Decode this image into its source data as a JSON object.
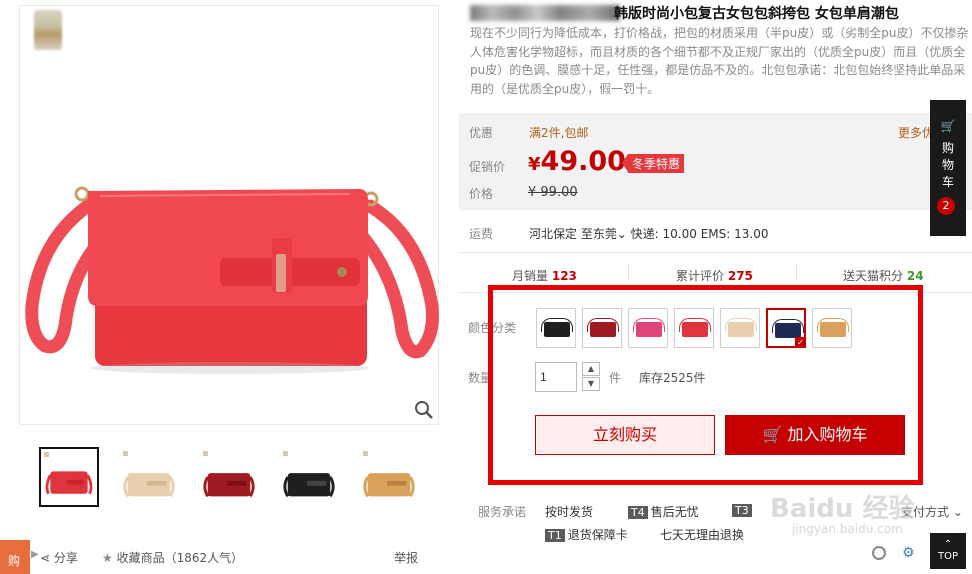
{
  "product": {
    "title": "韩版时尚小包复古女包包斜挎包 女包单肩潮包",
    "description": "现在不少同行为降低成本，打价格战，把包的材质采用（半pu皮）或（劣制全pu皮）不仅掺杂人体危害化学物超标，而且材质的各个细节都不及正规厂家出的（优质全pu皮）而且（优质全pu皮）的色调、膜感十足，任性强，都是仿品不及的。北包包承诺：北包包始终坚持此单品采用的（是优质全pu皮），假一罚十。"
  },
  "promo": {
    "label": "优惠",
    "value": "满2件,包邮",
    "more": "更多优"
  },
  "price": {
    "label": "促销价",
    "currency": "¥",
    "value": "49.00",
    "tag": "冬季特惠"
  },
  "original_price": {
    "label": "价格",
    "value": "¥ 99.00"
  },
  "shipping": {
    "label": "运费",
    "value": "河北保定  至东莞⌄ 快递: 10.00 EMS: 13.00"
  },
  "stats": [
    {
      "label": "月销量",
      "value": "123"
    },
    {
      "label": "累计评价",
      "value": "275"
    },
    {
      "label": "送天猫积分",
      "value": "24"
    }
  ],
  "sku": {
    "color_label": "颜色分类",
    "colors": [
      {
        "name": "black",
        "hex": "#1f1f1f"
      },
      {
        "name": "wine",
        "hex": "#9e1b22"
      },
      {
        "name": "rose",
        "hex": "#e0457a"
      },
      {
        "name": "red",
        "hex": "#e0343d"
      },
      {
        "name": "beige",
        "hex": "#e8cfb0"
      },
      {
        "name": "navy",
        "hex": "#1f2a55"
      },
      {
        "name": "camel",
        "hex": "#d9a15c"
      }
    ],
    "selected_color": 5,
    "qty_label": "数量",
    "qty_value": "1",
    "qty_unit": "件",
    "stock": "库存2525件"
  },
  "actions": {
    "buy_now": "立刻购买",
    "add_to_cart": "加入购物车"
  },
  "service": {
    "label": "服务承诺",
    "items": [
      "按时发货",
      "售后无忧",
      "退货保障卡",
      "七天无理由退换"
    ],
    "badges": [
      "T4",
      "T3",
      "T1"
    ],
    "pay": "支付方式 ⌄"
  },
  "gallery": {
    "thumbs": [
      {
        "hex": "#e0343d"
      },
      {
        "hex": "#e8cfb0"
      },
      {
        "hex": "#9e1b22"
      },
      {
        "hex": "#1f1f1f"
      },
      {
        "hex": "#d9a15c"
      }
    ],
    "active": 0
  },
  "footer": {
    "share": "分享",
    "favorite": "收藏商品（1862人气）",
    "report": "举报",
    "mini_cart": "购"
  },
  "side": {
    "cart_text": [
      "购",
      "物",
      "车"
    ],
    "cart_count": "2",
    "top": "TOP"
  },
  "watermark": {
    "main": "Baidu 经验",
    "sub": "jingyan.baidu.com"
  },
  "colors": {
    "accent": "#c40000",
    "highlight": "#e60000"
  }
}
